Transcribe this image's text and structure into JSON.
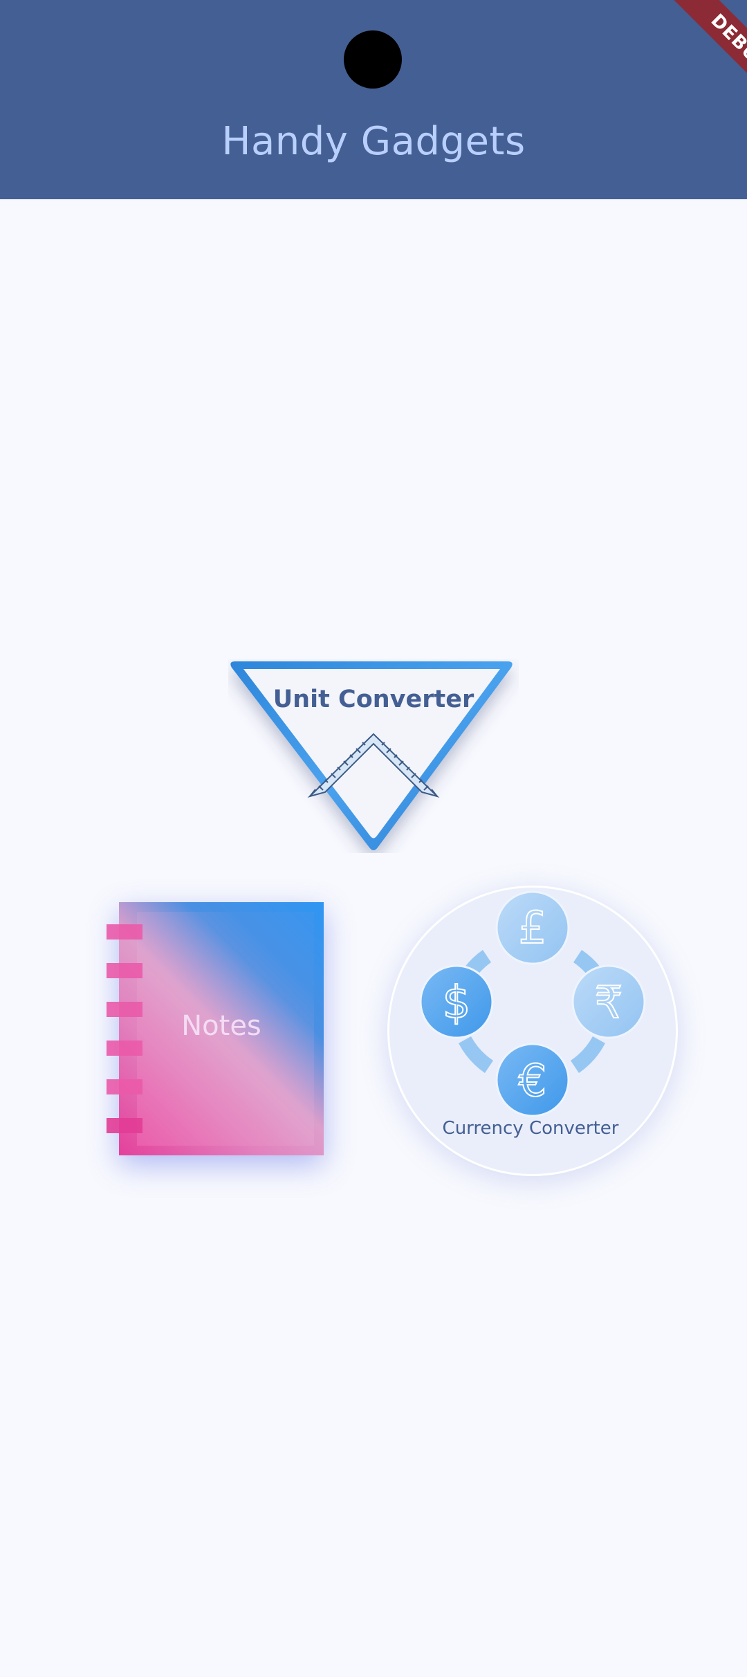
{
  "app_bar": {
    "title": "Handy Gadgets",
    "background": "#445f93",
    "title_color": "#b9d0ff"
  },
  "debug_banner": {
    "label": "DEBUG"
  },
  "tiles": {
    "unit_converter": {
      "label": "Unit Converter",
      "icon": "set-square-ruler-icon"
    },
    "notes": {
      "label": "Notes",
      "icon": "notebook-icon"
    },
    "currency_converter": {
      "label": "Currency Converter",
      "symbols": [
        "£",
        "₹",
        "€",
        "$"
      ]
    }
  }
}
